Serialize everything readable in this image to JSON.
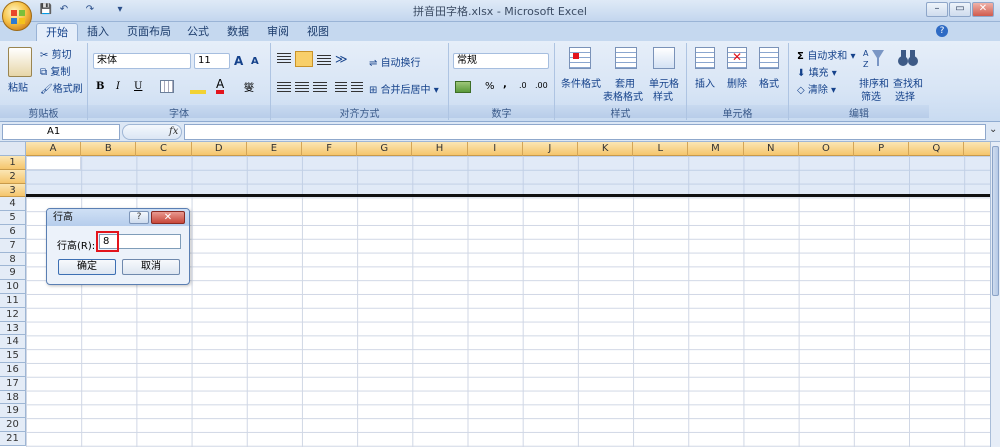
{
  "window": {
    "title": "拼音田字格.xlsx - Microsoft Excel",
    "min": "–",
    "max": "▭",
    "close": "✕"
  },
  "qat": {
    "save": "💾",
    "undo": "↶",
    "redo": "↷",
    "more": "▾"
  },
  "tabs": [
    "开始",
    "插入",
    "页面布局",
    "公式",
    "数据",
    "审阅",
    "视图"
  ],
  "ribbon": {
    "clipboard": {
      "label": "剪贴板",
      "paste": "粘贴",
      "cut": "剪切",
      "copy": "复制",
      "format_painter": "格式刷"
    },
    "font": {
      "label": "字体",
      "name": "宋体",
      "size": "11",
      "bold": "B",
      "italic": "I",
      "underline": "U",
      "grow": "A",
      "shrink": "A",
      "fill_color": "#f2d233",
      "font_color": "#e3141c"
    },
    "alignment": {
      "label": "对齐方式",
      "wrap": "自动换行",
      "merge": "合并后居中"
    },
    "number": {
      "label": "数字",
      "format": "常规",
      "percent": "%",
      "comma": ","
    },
    "styles": {
      "label": "样式",
      "conditional": "条件格式",
      "table_line1": "套用",
      "table_line2": "表格格式",
      "cell_line1": "单元格",
      "cell_line2": "样式"
    },
    "cells": {
      "label": "单元格",
      "insert": "插入",
      "delete": "删除",
      "format": "格式"
    },
    "editing": {
      "label": "编辑",
      "autosum": "自动求和",
      "fill": "填充",
      "clear": "清除",
      "sort_line1": "排序和",
      "sort_line2": "筛选",
      "find_line1": "查找和",
      "find_line2": "选择"
    }
  },
  "formula_bar": {
    "name_box": "A1",
    "fx": "fx",
    "formula": ""
  },
  "columns": [
    "A",
    "B",
    "C",
    "D",
    "E",
    "F",
    "G",
    "H",
    "I",
    "J",
    "K",
    "L",
    "M",
    "N",
    "O",
    "P",
    "Q"
  ],
  "rows": [
    "1",
    "2",
    "3",
    "4",
    "5",
    "6",
    "7",
    "8",
    "9",
    "10",
    "11",
    "12",
    "13",
    "14",
    "15",
    "16",
    "17",
    "18",
    "19",
    "20",
    "21"
  ],
  "selected_rows": [
    "1",
    "2",
    "3"
  ],
  "dialog": {
    "title": "行高",
    "help": "?",
    "close": "✕",
    "field_label": "行高(R):",
    "field_value": "8",
    "ok": "确定",
    "cancel": "取消"
  }
}
